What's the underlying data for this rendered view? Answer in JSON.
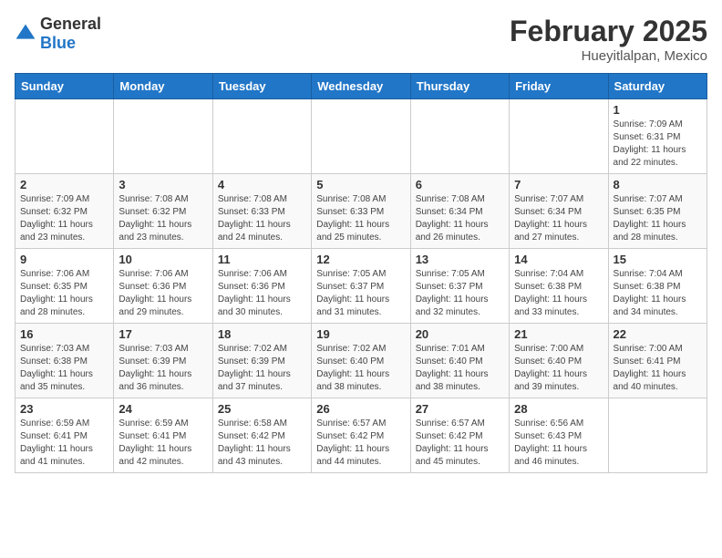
{
  "header": {
    "logo_general": "General",
    "logo_blue": "Blue",
    "month_title": "February 2025",
    "location": "Hueyitlalpan, Mexico"
  },
  "weekdays": [
    "Sunday",
    "Monday",
    "Tuesday",
    "Wednesday",
    "Thursday",
    "Friday",
    "Saturday"
  ],
  "weeks": [
    [
      {
        "day": "",
        "info": ""
      },
      {
        "day": "",
        "info": ""
      },
      {
        "day": "",
        "info": ""
      },
      {
        "day": "",
        "info": ""
      },
      {
        "day": "",
        "info": ""
      },
      {
        "day": "",
        "info": ""
      },
      {
        "day": "1",
        "info": "Sunrise: 7:09 AM\nSunset: 6:31 PM\nDaylight: 11 hours\nand 22 minutes."
      }
    ],
    [
      {
        "day": "2",
        "info": "Sunrise: 7:09 AM\nSunset: 6:32 PM\nDaylight: 11 hours\nand 23 minutes."
      },
      {
        "day": "3",
        "info": "Sunrise: 7:08 AM\nSunset: 6:32 PM\nDaylight: 11 hours\nand 23 minutes."
      },
      {
        "day": "4",
        "info": "Sunrise: 7:08 AM\nSunset: 6:33 PM\nDaylight: 11 hours\nand 24 minutes."
      },
      {
        "day": "5",
        "info": "Sunrise: 7:08 AM\nSunset: 6:33 PM\nDaylight: 11 hours\nand 25 minutes."
      },
      {
        "day": "6",
        "info": "Sunrise: 7:08 AM\nSunset: 6:34 PM\nDaylight: 11 hours\nand 26 minutes."
      },
      {
        "day": "7",
        "info": "Sunrise: 7:07 AM\nSunset: 6:34 PM\nDaylight: 11 hours\nand 27 minutes."
      },
      {
        "day": "8",
        "info": "Sunrise: 7:07 AM\nSunset: 6:35 PM\nDaylight: 11 hours\nand 28 minutes."
      }
    ],
    [
      {
        "day": "9",
        "info": "Sunrise: 7:06 AM\nSunset: 6:35 PM\nDaylight: 11 hours\nand 28 minutes."
      },
      {
        "day": "10",
        "info": "Sunrise: 7:06 AM\nSunset: 6:36 PM\nDaylight: 11 hours\nand 29 minutes."
      },
      {
        "day": "11",
        "info": "Sunrise: 7:06 AM\nSunset: 6:36 PM\nDaylight: 11 hours\nand 30 minutes."
      },
      {
        "day": "12",
        "info": "Sunrise: 7:05 AM\nSunset: 6:37 PM\nDaylight: 11 hours\nand 31 minutes."
      },
      {
        "day": "13",
        "info": "Sunrise: 7:05 AM\nSunset: 6:37 PM\nDaylight: 11 hours\nand 32 minutes."
      },
      {
        "day": "14",
        "info": "Sunrise: 7:04 AM\nSunset: 6:38 PM\nDaylight: 11 hours\nand 33 minutes."
      },
      {
        "day": "15",
        "info": "Sunrise: 7:04 AM\nSunset: 6:38 PM\nDaylight: 11 hours\nand 34 minutes."
      }
    ],
    [
      {
        "day": "16",
        "info": "Sunrise: 7:03 AM\nSunset: 6:38 PM\nDaylight: 11 hours\nand 35 minutes."
      },
      {
        "day": "17",
        "info": "Sunrise: 7:03 AM\nSunset: 6:39 PM\nDaylight: 11 hours\nand 36 minutes."
      },
      {
        "day": "18",
        "info": "Sunrise: 7:02 AM\nSunset: 6:39 PM\nDaylight: 11 hours\nand 37 minutes."
      },
      {
        "day": "19",
        "info": "Sunrise: 7:02 AM\nSunset: 6:40 PM\nDaylight: 11 hours\nand 38 minutes."
      },
      {
        "day": "20",
        "info": "Sunrise: 7:01 AM\nSunset: 6:40 PM\nDaylight: 11 hours\nand 38 minutes."
      },
      {
        "day": "21",
        "info": "Sunrise: 7:00 AM\nSunset: 6:40 PM\nDaylight: 11 hours\nand 39 minutes."
      },
      {
        "day": "22",
        "info": "Sunrise: 7:00 AM\nSunset: 6:41 PM\nDaylight: 11 hours\nand 40 minutes."
      }
    ],
    [
      {
        "day": "23",
        "info": "Sunrise: 6:59 AM\nSunset: 6:41 PM\nDaylight: 11 hours\nand 41 minutes."
      },
      {
        "day": "24",
        "info": "Sunrise: 6:59 AM\nSunset: 6:41 PM\nDaylight: 11 hours\nand 42 minutes."
      },
      {
        "day": "25",
        "info": "Sunrise: 6:58 AM\nSunset: 6:42 PM\nDaylight: 11 hours\nand 43 minutes."
      },
      {
        "day": "26",
        "info": "Sunrise: 6:57 AM\nSunset: 6:42 PM\nDaylight: 11 hours\nand 44 minutes."
      },
      {
        "day": "27",
        "info": "Sunrise: 6:57 AM\nSunset: 6:42 PM\nDaylight: 11 hours\nand 45 minutes."
      },
      {
        "day": "28",
        "info": "Sunrise: 6:56 AM\nSunset: 6:43 PM\nDaylight: 11 hours\nand 46 minutes."
      },
      {
        "day": "",
        "info": ""
      }
    ]
  ]
}
